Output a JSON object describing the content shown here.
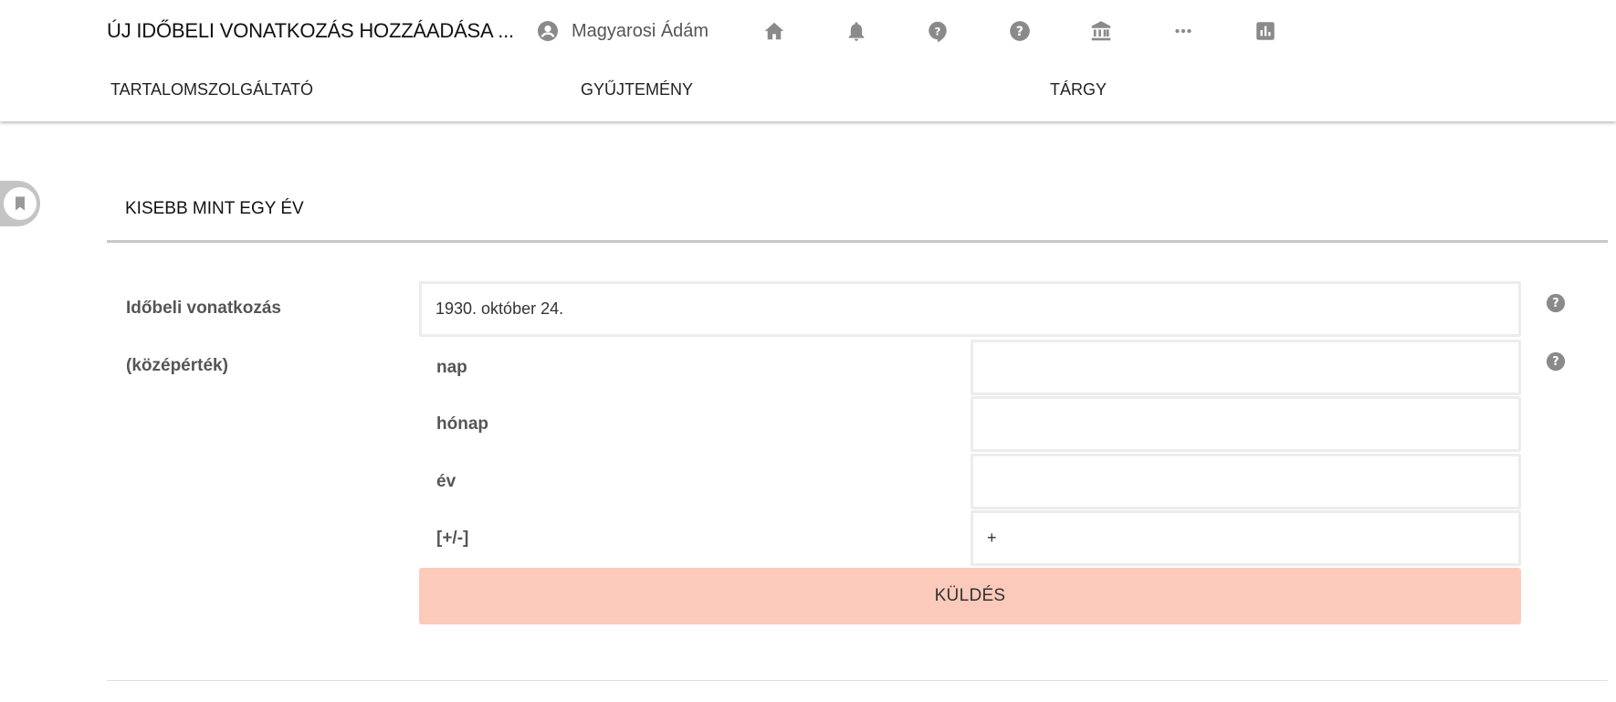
{
  "header": {
    "title": "ÚJ IDŐBELI VONATKOZÁS HOZZÁADÁSA ...",
    "user_name": "Magyarosi Ádám",
    "nav_icons": [
      "home-icon",
      "bell-icon",
      "help-bubble-icon",
      "help-circle-icon",
      "institution-icon",
      "more-icon",
      "chart-icon"
    ]
  },
  "tabs": [
    "TARTALOMSZOLGÁLTATÓ",
    "GYŰJTEMÉNY",
    "TÁRGY"
  ],
  "section": {
    "title": "KISEBB MINT EGY ÉV"
  },
  "form": {
    "temporal_label": "Időbeli vonatkozás",
    "temporal_value": "1930. október 24.",
    "mean_label": "(középérték)",
    "day_label": "nap",
    "day_value": "",
    "month_label": "hónap",
    "month_value": "",
    "year_label": "év",
    "year_value": "",
    "plusminus_label": "[+/-]",
    "plusminus_value": "+",
    "submit_label": "KÜLDÉS"
  },
  "colors": {
    "submit_bg": "#fccabb",
    "icon_gray": "#8a8a8a",
    "rule": "#c8c8c8"
  }
}
